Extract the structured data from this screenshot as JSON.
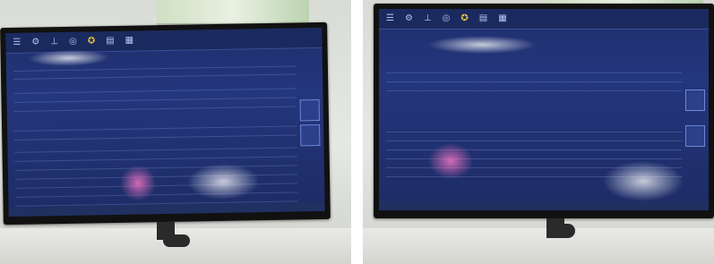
{
  "photos": [
    {
      "name": "left-photo"
    },
    {
      "name": "right-photo"
    }
  ]
}
